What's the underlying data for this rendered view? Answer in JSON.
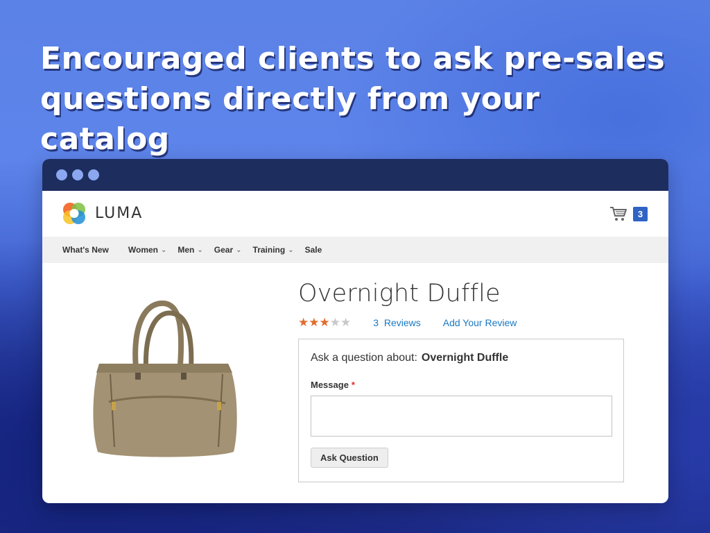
{
  "headline": "Encouraged clients to ask pre-sales questions directly from your catalog",
  "site": {
    "logo_text": "LUMA",
    "cart_count": "3"
  },
  "nav": {
    "items": [
      {
        "label": "What's New"
      },
      {
        "label": "Women"
      },
      {
        "label": "Men"
      },
      {
        "label": "Gear"
      },
      {
        "label": "Training"
      },
      {
        "label": "Sale"
      }
    ]
  },
  "product": {
    "title": "Overnight Duffle",
    "rating_stars": 3,
    "rating_max": 5,
    "reviews_count": "3",
    "reviews_label": "Reviews",
    "add_review": "Add Your Review"
  },
  "question_form": {
    "heading_prefix": "Ask a question about:",
    "product_name": "Overnight Duffle",
    "message_label": "Message",
    "required_mark": "*",
    "message_value": "",
    "submit_label": "Ask Question"
  },
  "colors": {
    "accent": "#2f63c4",
    "link": "#1979c3",
    "star": "#e26b2d",
    "titlebar": "#1d2d5e"
  }
}
